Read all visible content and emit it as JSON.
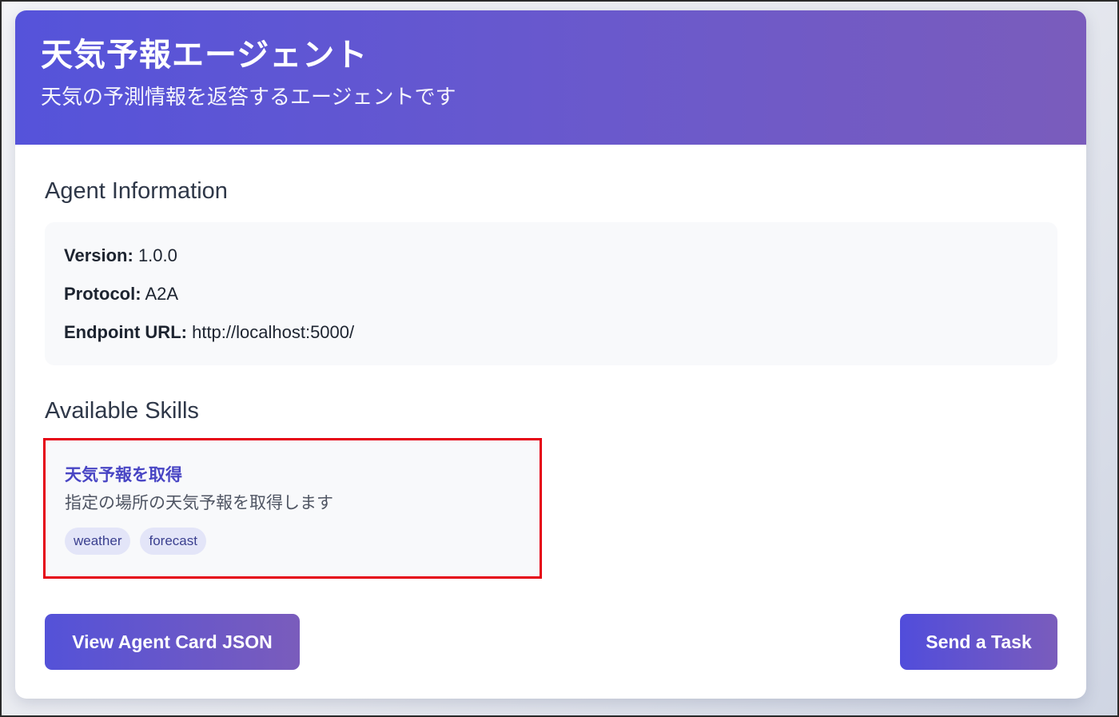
{
  "header": {
    "title": "天気予報エージェント",
    "subtitle": "天気の予測情報を返答するエージェントです"
  },
  "agent_info": {
    "section_title": "Agent Information",
    "rows": [
      {
        "label": "Version:",
        "value": "1.0.0"
      },
      {
        "label": "Protocol:",
        "value": "A2A"
      },
      {
        "label": "Endpoint URL:",
        "value": "http://localhost:5000/"
      }
    ]
  },
  "skills": {
    "section_title": "Available Skills",
    "items": [
      {
        "name": "天気予報を取得",
        "description": "指定の場所の天気予報を取得します",
        "tags": [
          "weather",
          "forecast"
        ]
      }
    ]
  },
  "actions": {
    "view_json_label": "View Agent Card JSON",
    "send_task_label": "Send a Task"
  },
  "colors": {
    "header_gradient_start": "#5553da",
    "header_gradient_end": "#7a5cbc",
    "skill_name": "#4845c4",
    "highlight_border": "#e50012",
    "tag_bg": "#e3e5f8"
  }
}
